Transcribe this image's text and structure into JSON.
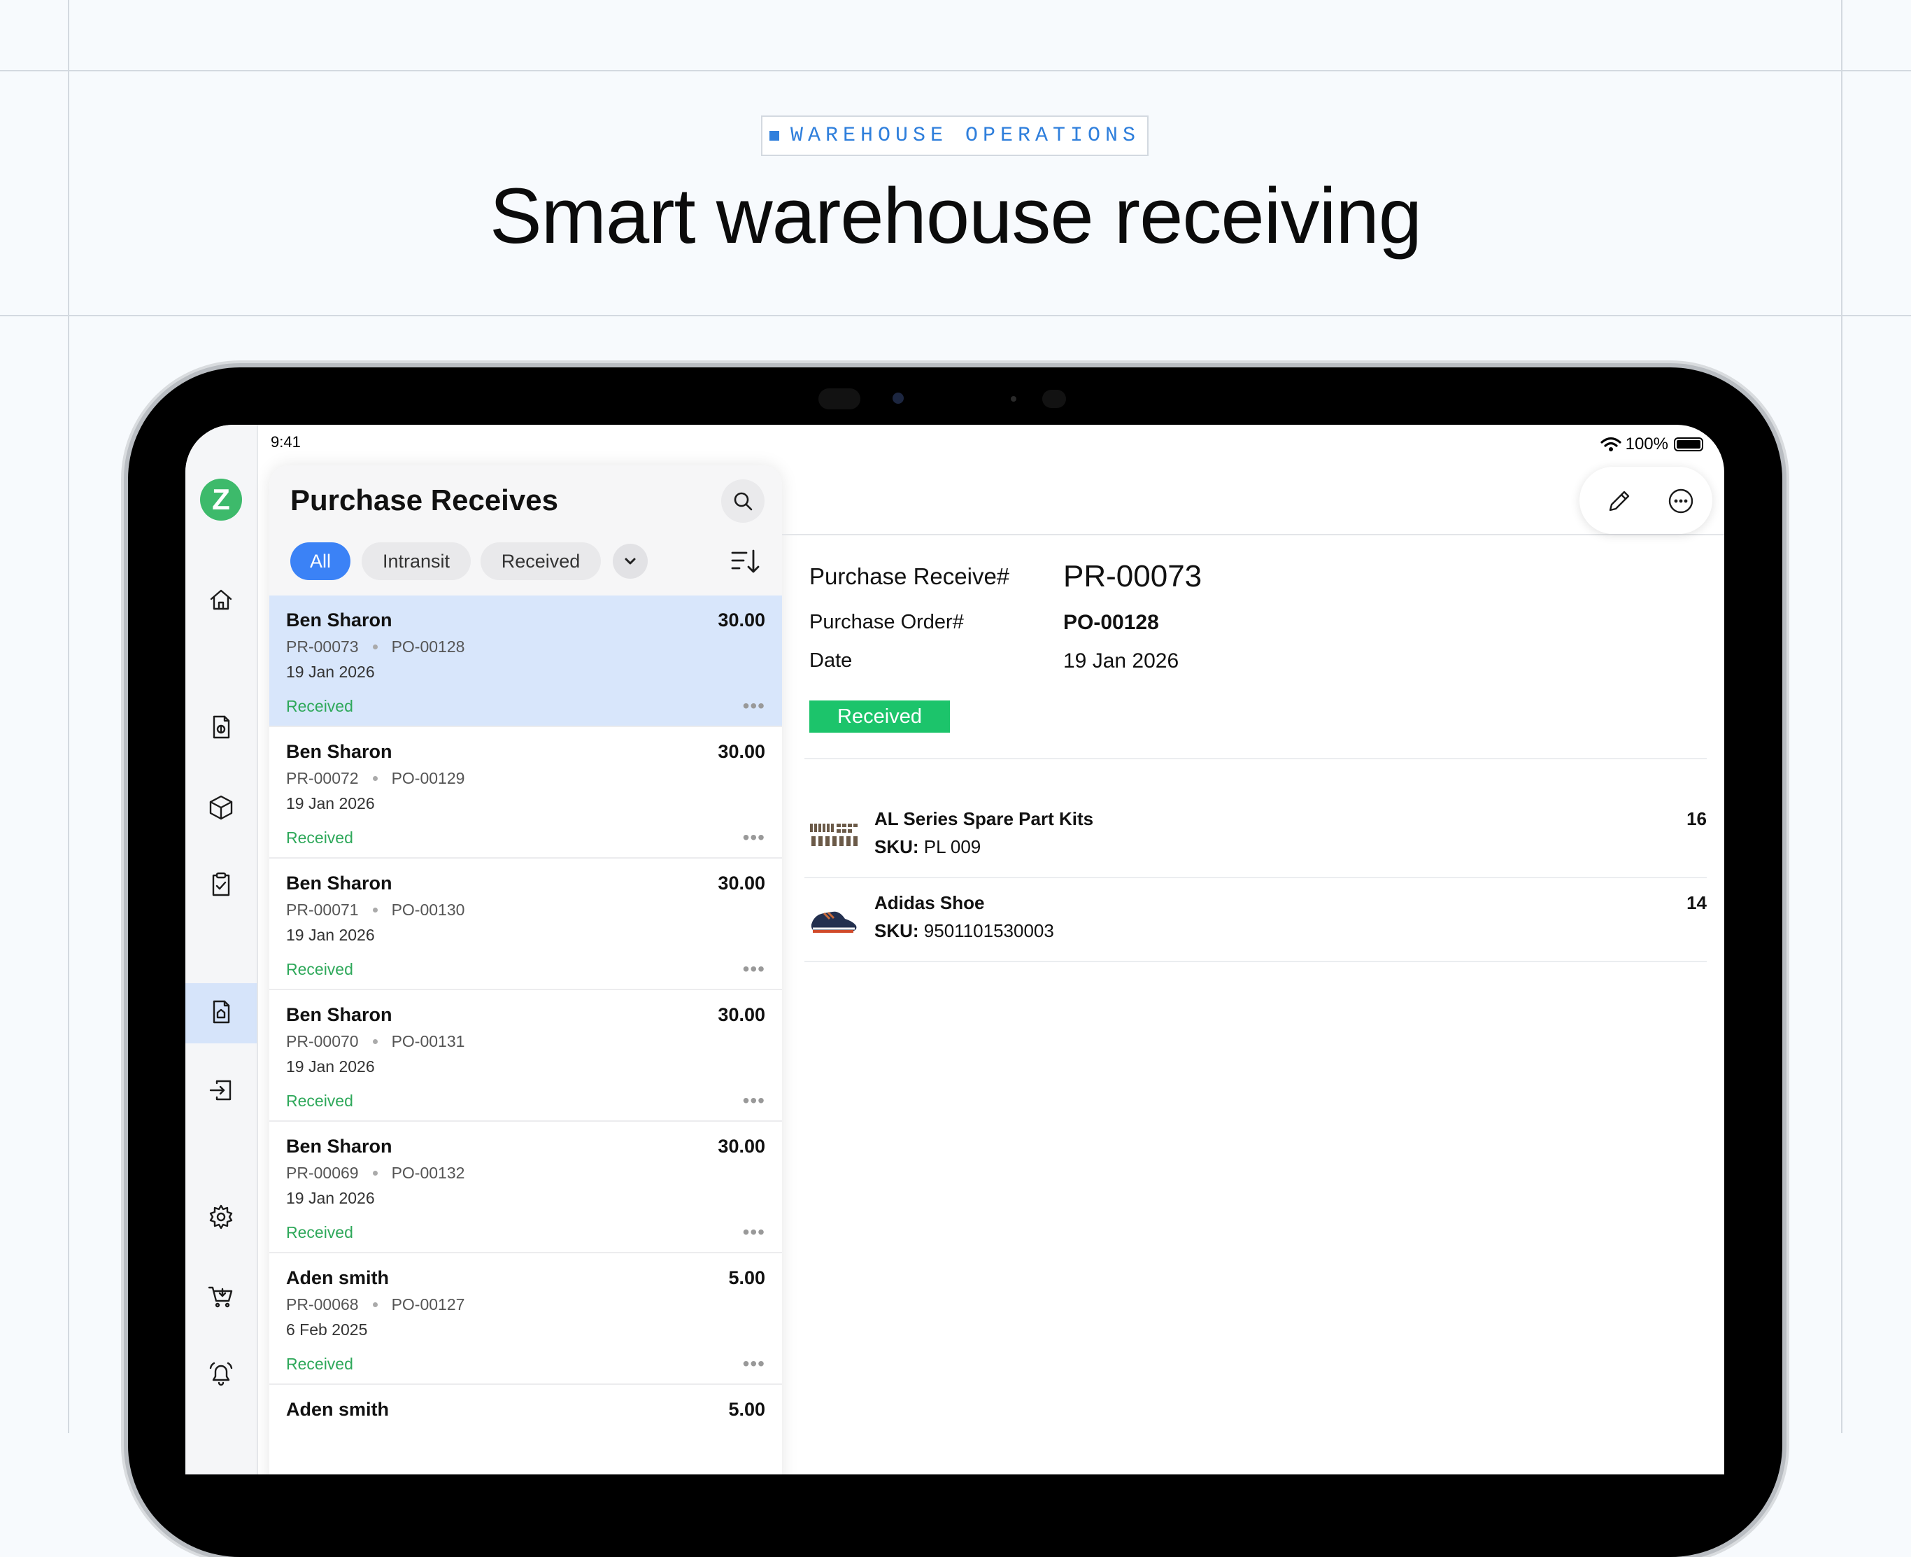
{
  "header": {
    "tag": "WAREHOUSE OPERATIONS",
    "headline": "Smart warehouse receiving"
  },
  "status_bar": {
    "time": "9:41",
    "battery": "100%"
  },
  "nav_rail": {
    "logo": "Z",
    "icons": [
      "home-icon",
      "invoice-icon",
      "box-icon",
      "clipboard-check-icon",
      "purchase-receive-icon",
      "transfer-icon",
      "gear-icon",
      "cart-icon",
      "bell-icon"
    ],
    "active": "purchase-receive-icon"
  },
  "list": {
    "title": "Purchase Receives",
    "filters": [
      "All",
      "Intransit",
      "Received"
    ],
    "active_filter": "All",
    "rows": [
      {
        "name": "Ben Sharon",
        "amount": "30.00",
        "pr": "PR-00073",
        "po": "PO-00128",
        "date": "19 Jan 2026",
        "status": "Received",
        "selected": true
      },
      {
        "name": "Ben Sharon",
        "amount": "30.00",
        "pr": "PR-00072",
        "po": "PO-00129",
        "date": "19 Jan 2026",
        "status": "Received"
      },
      {
        "name": "Ben Sharon",
        "amount": "30.00",
        "pr": "PR-00071",
        "po": "PO-00130",
        "date": "19 Jan 2026",
        "status": "Received"
      },
      {
        "name": "Ben Sharon",
        "amount": "30.00",
        "pr": "PR-00070",
        "po": "PO-00131",
        "date": "19 Jan 2026",
        "status": "Received"
      },
      {
        "name": "Ben Sharon",
        "amount": "30.00",
        "pr": "PR-00069",
        "po": "PO-00132",
        "date": "19 Jan 2026",
        "status": "Received"
      },
      {
        "name": "Aden smith",
        "amount": "5.00",
        "pr": "PR-00068",
        "po": "PO-00127",
        "date": "6 Feb 2025",
        "status": "Received"
      },
      {
        "name": "Aden smith",
        "amount": "5.00",
        "pr": "",
        "po": "",
        "date": "",
        "status": ""
      }
    ]
  },
  "detail": {
    "receive_label": "Purchase Receive#",
    "receive_value": "PR-00073",
    "order_label": "Purchase Order#",
    "order_value": "PO-00128",
    "date_label": "Date",
    "date_value": "19 Jan 2026",
    "status": "Received",
    "status_color": "#1cc46b",
    "sku_label": "SKU:",
    "items": [
      {
        "name": "AL Series Spare Part Kits",
        "sku": "PL 009",
        "qty": "16",
        "thumb": "spare-parts-thumbnail"
      },
      {
        "name": "Adidas Shoe",
        "sku": "9501101530003",
        "qty": "14",
        "thumb": "shoe-thumbnail"
      }
    ]
  },
  "colors": {
    "accent": "#3b82f6",
    "received": "#2ea85a",
    "logo": "#3dba6b",
    "tag": "#2f7fdc"
  }
}
